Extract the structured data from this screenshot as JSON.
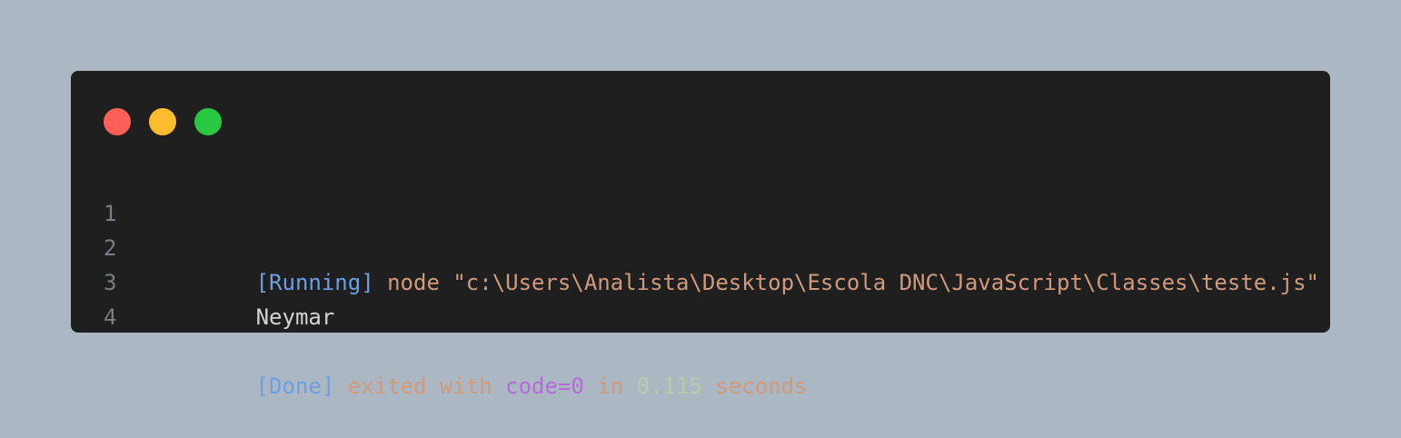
{
  "colors": {
    "page_bg": "#abb8c3",
    "window_bg": "#1f1f1f",
    "dot_red": "#ff5f57",
    "dot_yellow": "#febc2e",
    "dot_green": "#28c840",
    "line_number": "#7a7f86",
    "tag_blue": "#6d9fe4",
    "string_orange": "#d19a7b",
    "text_plain": "#d4d4d4",
    "keyword_purple": "#b36bd9",
    "number_green": "#b5cea8"
  },
  "window_controls": {
    "close": "red-dot",
    "minimize": "yellow-dot",
    "maximize": "green-dot"
  },
  "lines": [
    {
      "number": "1",
      "tokens": [
        {
          "text": "[Running]",
          "color": "#6d9fe4"
        },
        {
          "text": " node \"c:\\Users\\Analista\\Desktop\\Escola DNC\\JavaScript\\Classes\\teste.js\"",
          "color": "#d19a7b"
        }
      ]
    },
    {
      "number": "2",
      "tokens": [
        {
          "text": "Neymar",
          "color": "#d4d4d4"
        }
      ]
    },
    {
      "number": "3",
      "tokens": []
    },
    {
      "number": "4",
      "tokens": [
        {
          "text": "[Done]",
          "color": "#6d9fe4"
        },
        {
          "text": " exited with ",
          "color": "#d19a7b"
        },
        {
          "text": "code=0",
          "color": "#b36bd9"
        },
        {
          "text": " in ",
          "color": "#d19a7b"
        },
        {
          "text": "0.115",
          "color": "#b5cea8"
        },
        {
          "text": " seconds",
          "color": "#d19a7b"
        }
      ]
    }
  ]
}
